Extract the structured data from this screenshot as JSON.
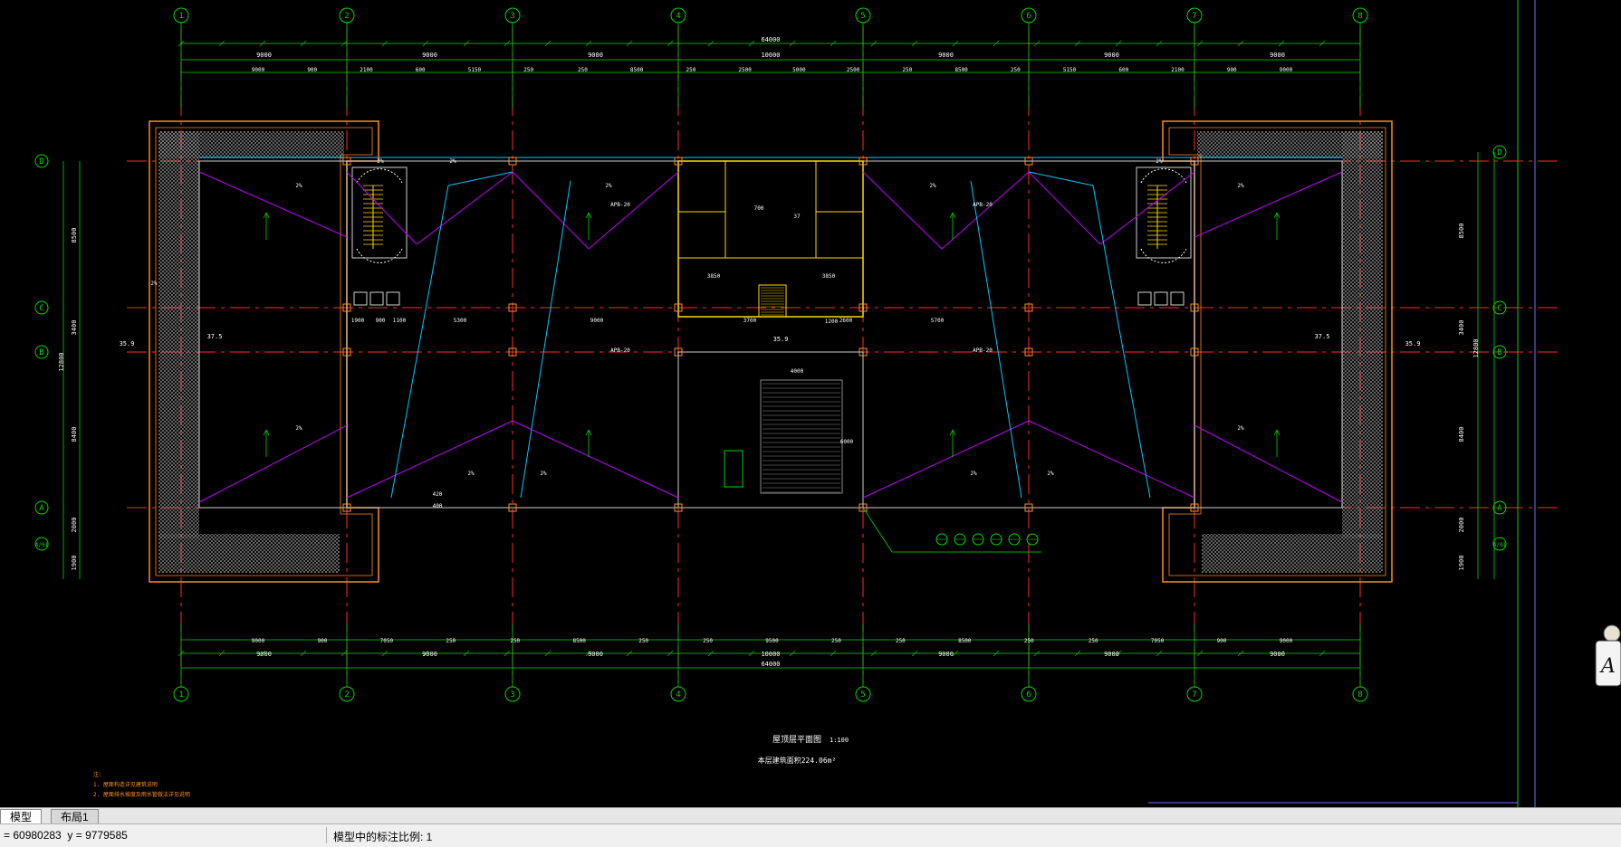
{
  "drawing": {
    "title": "屋顶层平面图",
    "scale_text": "1:100",
    "area_text": "本层建筑面积224.06m²",
    "axis_columns": [
      "1",
      "2",
      "3",
      "4",
      "5",
      "6",
      "7",
      "8"
    ],
    "axis_rows": [
      "D",
      "C",
      "B",
      "A",
      "A/01"
    ],
    "top_dims_total": "64000",
    "top_dims_row1": [
      "9000",
      "9000",
      "9000",
      "10000",
      "9000",
      "9000",
      "9000"
    ],
    "top_dims_row2": [
      "9000",
      "900",
      "2100",
      "600",
      "5150",
      "250",
      "250",
      "8500",
      "250",
      "2500",
      "5000",
      "2500",
      "250",
      "8500",
      "250",
      "5150",
      "600",
      "2100",
      "900",
      "9000"
    ],
    "bottom_dims_row1": [
      "9000",
      "900",
      "7050",
      "250",
      "250",
      "8500",
      "250",
      "250",
      "9500",
      "250",
      "250",
      "8500",
      "250",
      "250",
      "7050",
      "900",
      "9000"
    ],
    "bottom_dims_row2": [
      "9000",
      "9000",
      "9000",
      "10000",
      "9000",
      "9000",
      "9000"
    ],
    "bottom_dims_total": "64000",
    "left_dims": [
      "8500",
      "3400",
      "8400",
      "2000",
      "1900",
      "12800"
    ],
    "right_dims": [
      "8500",
      "3400",
      "8400",
      "2000",
      "1900",
      "12800"
    ],
    "slope_labels": [
      "2%",
      "2%",
      "2%",
      "2%",
      "2%",
      "2%",
      "2%",
      "2%",
      "2%",
      "2%",
      "2%",
      "2%",
      "2%",
      "2%"
    ],
    "elev_labels": [
      "35.9",
      "37.5",
      "35.9",
      "37.5",
      "35.9"
    ],
    "notes": [
      "注:",
      "1. 屋面构造详见建筑说明",
      "2. 屋面排水坡度及雨水管做法详见说明"
    ],
    "misc_labels": [
      "APB-20",
      "APB-20",
      "APB-20",
      "APB-20",
      "3850",
      "3850",
      "1900",
      "900",
      "1100",
      "5300",
      "9000",
      "3700",
      "5700",
      "1200",
      "4000",
      "6000",
      "400",
      "420",
      "2600",
      "700",
      "37"
    ]
  },
  "tabs": [
    {
      "label": "模型",
      "active": true
    },
    {
      "label": "布局1",
      "active": false
    }
  ],
  "status": {
    "coords": "= 60980283  y = 9779585",
    "annotation_scale": "模型中的标注比例: 1"
  },
  "colors": {
    "background": "#000000",
    "axis_red": "#ff2a2a",
    "dim_green": "#00d800",
    "wall_yellow": "#ffd800",
    "slope_magenta": "#c000ff",
    "drain_cyan": "#00c8ff",
    "parapet_orange": "#ff8c1a",
    "hatch_gray": "#9a9a9a"
  }
}
